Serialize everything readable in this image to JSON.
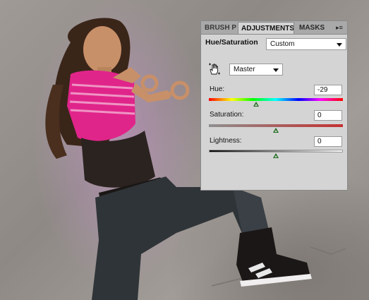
{
  "panel": {
    "tabs": [
      {
        "label": "BRUSH P"
      },
      {
        "label": "ADJUSTMENTS"
      },
      {
        "label": "MASKS"
      }
    ],
    "menu_icon": "panel-menu-icon",
    "title": "Hue/Saturation",
    "preset": {
      "value": "Custom"
    },
    "channel": {
      "value": "Master"
    },
    "hue": {
      "label": "Hue:",
      "value": "-29"
    },
    "saturation": {
      "label": "Saturation:",
      "value": "0"
    },
    "lightness": {
      "label": "Lightness:",
      "value": "0"
    }
  }
}
